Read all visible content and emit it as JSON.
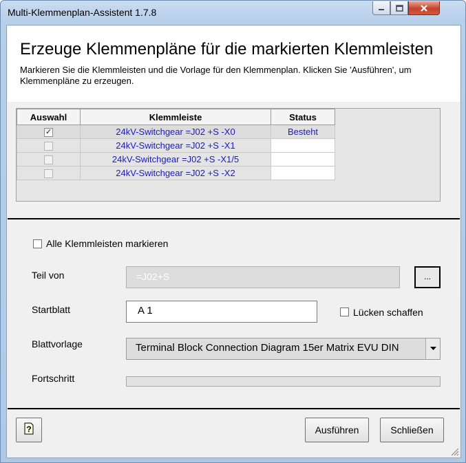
{
  "window": {
    "title": "Multi-Klemmenplan-Assistent 1.7.8"
  },
  "header": {
    "title": "Erzeuge Klemmenpläne für die markierten Klemmleisten",
    "description": "Markieren Sie die Klemmleisten und die Vorlage für den Klemmenplan. Klicken Sie 'Ausführen', um Klemmenpläne zu erzeugen."
  },
  "table": {
    "columns": [
      "Auswahl",
      "Klemmleiste",
      "Status"
    ],
    "rows": [
      {
        "checked": true,
        "klemmleiste": "24kV-Switchgear =J02 +S -X0",
        "status": "Besteht"
      },
      {
        "checked": false,
        "klemmleiste": "24kV-Switchgear =J02 +S -X1",
        "status": ""
      },
      {
        "checked": false,
        "klemmleiste": "24kV-Switchgear =J02 +S -X1/5",
        "status": ""
      },
      {
        "checked": false,
        "klemmleiste": "24kV-Switchgear =J02 +S -X2",
        "status": ""
      }
    ]
  },
  "form": {
    "select_all_label": "Alle Klemmleisten markieren",
    "teil_von_label": "Teil von",
    "teil_von_value": "=J02+S",
    "browse_label": "...",
    "startblatt_label": "Startblatt",
    "startblatt_value": "A 1",
    "luecken_label": "Lücken schaffen",
    "blattvorlage_label": "Blattvorlage",
    "blattvorlage_value": "Terminal Block Connection Diagram 15er Matrix EVU DIN",
    "fortschritt_label": "Fortschritt",
    "progress_value": 0
  },
  "buttons": {
    "help": "?",
    "run": "Ausführen",
    "close": "Schließen"
  },
  "icons": {
    "minimize": "minimize-icon",
    "maximize": "maximize-icon",
    "close": "close-icon",
    "help": "help-icon",
    "dropdown": "chevron-down-icon",
    "grip": "resize-grip-icon"
  }
}
